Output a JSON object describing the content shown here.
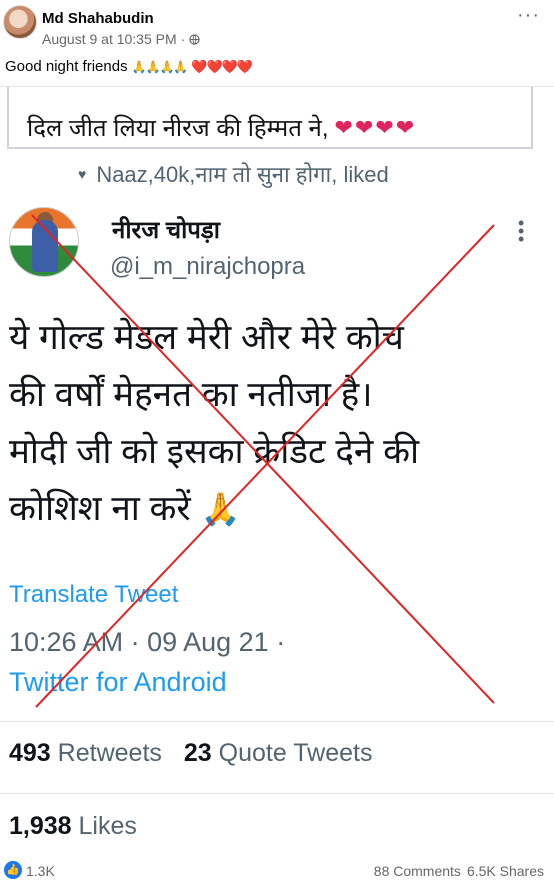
{
  "post": {
    "author": "Md Shahabudin",
    "timestamp": "August 9 at 10:35 PM",
    "separator": "·",
    "caption_text": "Good night friends",
    "caption_emojis": "🙏🙏🙏🙏",
    "caption_hearts": "❤️❤️❤️❤️",
    "icons": {
      "avatar": "profile-photo",
      "privacy": "globe-icon",
      "menu": "more-icon"
    }
  },
  "screenshot": {
    "hindi_caption": "दिल जीत लिया नीरज की हिम्मत ने,",
    "hindi_caption_hearts": "❤❤❤❤",
    "liked_by": "Naaz,40k,नाम तो सुना होगा, liked",
    "tweet": {
      "name": "नीरज चोपड़ा",
      "handle": "@i_m_nirajchopra",
      "text_lines": [
        "ये गोल्ड मेडल मेरी और मेरे कोच",
        "की वर्षों मेहनत का नतीजा है।",
        "मोदी जी को इसका क्रेडिट देने की",
        "कोशिश ना करें"
      ],
      "pray_emoji": "🙏",
      "translate_label": "Translate Tweet",
      "time": "10:26 AM · 09 Aug 21 ·",
      "source": "Twitter for Android",
      "retweets_count": "493",
      "retweets_label": "Retweets",
      "quote_count": "23",
      "quote_label": "Quote Tweets",
      "likes_count": "1,938",
      "likes_label": "Likes"
    },
    "cross_color": "#e02424"
  },
  "footer": {
    "reactions_count": "1.3K",
    "comments": "88 Comments",
    "shares": "6.5K Shares",
    "like_icon": "like-icon"
  }
}
